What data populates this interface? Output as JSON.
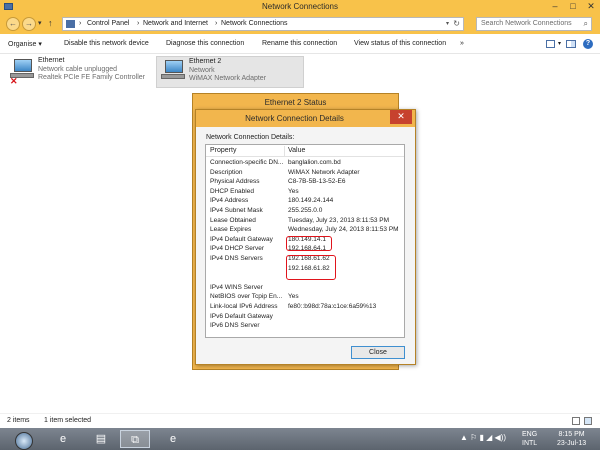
{
  "window": {
    "title": "Network Connections",
    "minimize": "–",
    "maximize": "□",
    "close": "✕"
  },
  "address": {
    "back": "←",
    "forward": "→",
    "recent": "▾",
    "up": "↑",
    "sep": "›",
    "crumbs": [
      "Control Panel",
      "Network and Internet",
      "Network Connections"
    ],
    "dropdown": "▾",
    "refresh": "↻",
    "search_placeholder": "Search Network Connections",
    "search_glyph": "⌕"
  },
  "commands": {
    "organise": "Organise ▾",
    "disable": "Disable this network device",
    "diagnose": "Diagnose this connection",
    "rename": "Rename this connection",
    "view_status": "View status of this connection",
    "more": "»",
    "view_dropdown": "▾",
    "help": "?"
  },
  "adapters": [
    {
      "name": "Ethernet",
      "status": "Network cable unplugged",
      "device": "Realtek PCIe FE Family Controller",
      "disconnected": true,
      "x_mark": "✕"
    },
    {
      "name": "Ethernet 2",
      "status": "Network",
      "device": "WiMAX Network Adapter",
      "disconnected": false
    }
  ],
  "status_dialog": {
    "title": "Ethernet 2 Status"
  },
  "details_dialog": {
    "title": "Network Connection Details",
    "close_glyph": "✕",
    "section_label": "Network Connection Details:",
    "headers": {
      "property": "Property",
      "value": "Value"
    },
    "rows": [
      {
        "property": "Connection-specific DN...",
        "value": "banglalion.com.bd"
      },
      {
        "property": "Description",
        "value": "WiMAX Network Adapter"
      },
      {
        "property": "Physical Address",
        "value": "C8-7B-5B-13-52-E6"
      },
      {
        "property": "DHCP Enabled",
        "value": "Yes"
      },
      {
        "property": "IPv4 Address",
        "value": "180.149.24.144"
      },
      {
        "property": "IPv4 Subnet Mask",
        "value": "255.255.0.0"
      },
      {
        "property": "Lease Obtained",
        "value": "Tuesday, July 23, 2013 8:11:53 PM"
      },
      {
        "property": "Lease Expires",
        "value": "Wednesday, July 24, 2013 8:11:53 PM"
      },
      {
        "property": "IPv4 Default Gateway",
        "value": "180.149.14.1"
      },
      {
        "property": "IPv4 DHCP Server",
        "value": "192.168.64.1"
      },
      {
        "property": "IPv4 DNS Servers",
        "value": "192.168.61.62"
      },
      {
        "property": "",
        "value": "192.168.61.82"
      },
      {
        "property": "",
        "value": ""
      },
      {
        "property": "IPv4 WINS Server",
        "value": ""
      },
      {
        "property": "NetBIOS over Tcpip En...",
        "value": "Yes"
      },
      {
        "property": "Link-local IPv6 Address",
        "value": "fe80::b98d:78a:c1ce:6a59%13"
      },
      {
        "property": "IPv6 Default Gateway",
        "value": ""
      },
      {
        "property": "IPv6 DNS Server",
        "value": ""
      }
    ],
    "close_button": "Close"
  },
  "statusbar": {
    "items": "2 items",
    "selected": "1 item selected"
  },
  "taskbar": {
    "ie": "e",
    "explorer": "▤",
    "network": "⧉",
    "ie2": "e",
    "tray": "▲ ⚐ ▮ ◢ ◀))",
    "lang_top": "ENG",
    "lang_bottom": "INTL",
    "time": "8:15 PM",
    "date": "23-Jul-13"
  }
}
